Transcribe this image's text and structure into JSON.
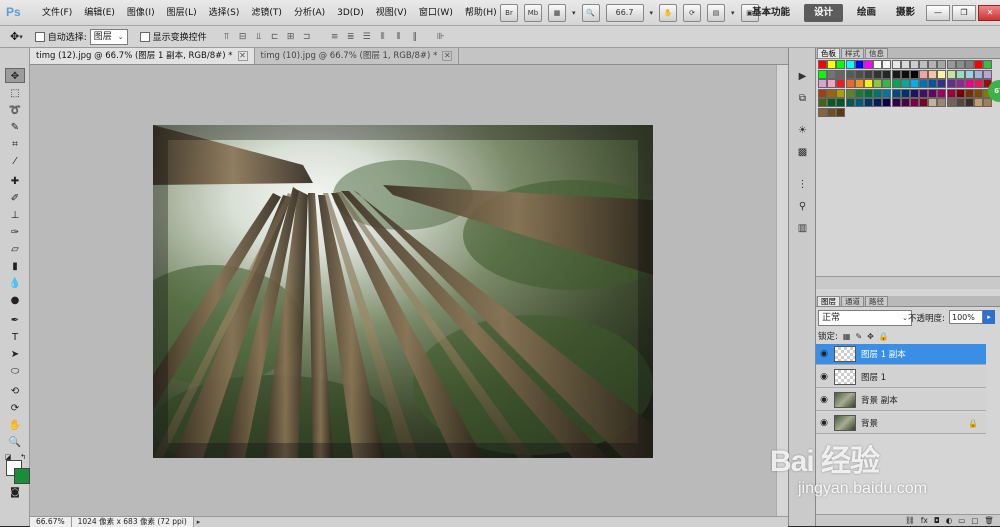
{
  "app": {
    "logo": "Ps",
    "menu": [
      "文件(F)",
      "编辑(E)",
      "图像(I)",
      "图层(L)",
      "选择(S)",
      "滤镜(T)",
      "分析(A)",
      "3D(D)",
      "视图(V)",
      "窗口(W)",
      "帮助(H)"
    ],
    "app_icons": [
      "Br",
      "Mb"
    ],
    "zoom_value": "66.7",
    "workspaces": [
      "基本功能",
      "设计",
      "绘画",
      "摄影"
    ],
    "active_workspace": "设计",
    "more": "»",
    "window_buttons": [
      "—",
      "❐",
      "✕"
    ]
  },
  "options_bar": {
    "auto_select_label": "自动选择:",
    "auto_select_value": "图层",
    "show_transform_label": "显示变换控件"
  },
  "document": {
    "tabs": [
      {
        "label": "timg (12).jpg @ 66.7% (图层 1 副本, RGB/8#) *",
        "active": true
      },
      {
        "label": "timg (10).jpg @ 66.7% (图层 1, RGB/8#) *",
        "active": false
      }
    ],
    "tab_close": "✕",
    "status_zoom": "66.67%",
    "status_doc": "1024 像素 x 683 像素 (72 ppi)"
  },
  "panels": {
    "swatches_tabs": [
      "色板",
      "样式",
      "信息"
    ],
    "swatch_colors": [
      "#ff0000",
      "#ffff00",
      "#00ff00",
      "#00ffff",
      "#0000ff",
      "#ff00ff",
      "#ffffff",
      "#f4f4f4",
      "#e6e6e6",
      "#d9d9d9",
      "#cccccc",
      "#bfbfbf",
      "#b3b3b3",
      "#a6a6a6",
      "#999999",
      "#8c8c8c",
      "#808080",
      "#ff0000",
      "#3bbf3b",
      "#00ff00",
      "#737373",
      "#666666",
      "#595959",
      "#4d4d4d",
      "#404040",
      "#333333",
      "#262626",
      "#1a1a1a",
      "#0d0d0d",
      "#000000",
      "#f2a3a3",
      "#f7c59f",
      "#fff5a0",
      "#c5e3a0",
      "#a0d8c4",
      "#a0cde8",
      "#a3b3e0",
      "#b9a3d8",
      "#d6a3d3",
      "#f2a3c6",
      "#ed1c24",
      "#f26522",
      "#f7941d",
      "#fff200",
      "#8dc63f",
      "#39b54a",
      "#00a651",
      "#00a99d",
      "#00aeef",
      "#0072bc",
      "#0054a6",
      "#2e3192",
      "#662d91",
      "#92278f",
      "#ec008c",
      "#ed145b",
      "#9e0b0f",
      "#a0410d",
      "#a36209",
      "#aba000",
      "#598527",
      "#197b30",
      "#007236",
      "#00746b",
      "#0076a3",
      "#004a80",
      "#003471",
      "#1b1464",
      "#440e62",
      "#630460",
      "#9e005d",
      "#9e0039",
      "#790000",
      "#7b2e00",
      "#7d4900",
      "#827b00",
      "#406618",
      "#005e20",
      "#005826",
      "#005952",
      "#005b7f",
      "#003663",
      "#002157",
      "#0d004c",
      "#32004b",
      "#4b0049",
      "#7b0046",
      "#7a0026",
      "#c7b299",
      "#998675",
      "#736357",
      "#534741",
      "#37302a",
      "#c69c6d",
      "#a67c52",
      "#8c6239",
      "#754c24",
      "#603913"
    ],
    "layers_tabs": [
      "图层",
      "通道",
      "路径"
    ],
    "blend_mode": "正常",
    "opacity_label": "不透明度:",
    "opacity_value": "100%",
    "lock_label": "锁定:",
    "layers": [
      {
        "name": "图层 1 副本",
        "active": true,
        "thumb": "transparent",
        "locked": false
      },
      {
        "name": "图层 1",
        "active": false,
        "thumb": "transparent",
        "locked": false
      },
      {
        "name": "背景 副本",
        "active": false,
        "thumb": "photo",
        "locked": false
      },
      {
        "name": "背景",
        "active": false,
        "thumb": "photo",
        "locked": true
      }
    ],
    "layers_footer_icons": [
      "link-icon",
      "fx-icon",
      "mask-icon",
      "adjustment-icon",
      "group-icon",
      "new-layer-icon",
      "trash-icon"
    ]
  },
  "badge": "67",
  "watermark": {
    "logo": "Bai 经验",
    "url": "jingyan.baidu.com"
  }
}
